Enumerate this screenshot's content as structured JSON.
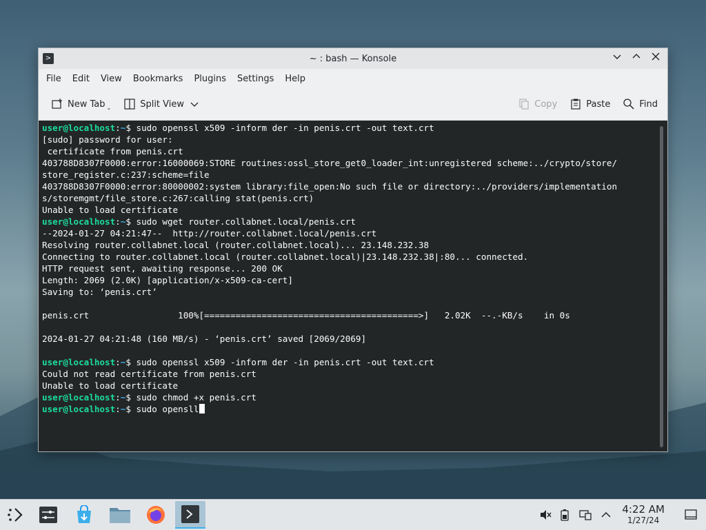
{
  "window": {
    "title": "~ : bash — Konsole",
    "controls": [
      "minimize",
      "maximize",
      "close"
    ]
  },
  "menubar": {
    "items": [
      "File",
      "Edit",
      "View",
      "Bookmarks",
      "Plugins",
      "Settings",
      "Help"
    ]
  },
  "toolbar": {
    "new_tab": "New Tab",
    "split_view": "Split View",
    "copy": "Copy",
    "paste": "Paste",
    "find": "Find"
  },
  "terminal": {
    "prompt_user": "user@localhost",
    "prompt_sep": ":",
    "prompt_path": "~",
    "prompt_end": "$ ",
    "lines": [
      {
        "type": "prompt",
        "cmd": "sudo openssl x509 -inform der -in penis.crt -out text.crt"
      },
      {
        "type": "out",
        "text": "[sudo] password for user:"
      },
      {
        "type": "out",
        "text": " certificate from penis.crt"
      },
      {
        "type": "out",
        "text": "403788D8307F0000:error:16000069:STORE routines:ossl_store_get0_loader_int:unregistered scheme:../crypto/store/"
      },
      {
        "type": "out",
        "text": "store_register.c:237:scheme=file"
      },
      {
        "type": "out",
        "text": "403788D8307F0000:error:80000002:system library:file_open:No such file or directory:../providers/implementation"
      },
      {
        "type": "out",
        "text": "s/storemgmt/file_store.c:267:calling stat(penis.crt)"
      },
      {
        "type": "out",
        "text": "Unable to load certificate"
      },
      {
        "type": "prompt",
        "cmd": "sudo wget router.collabnet.local/penis.crt"
      },
      {
        "type": "out",
        "text": "--2024-01-27 04:21:47--  http://router.collabnet.local/penis.crt"
      },
      {
        "type": "out",
        "text": "Resolving router.collabnet.local (router.collabnet.local)... 23.148.232.38"
      },
      {
        "type": "out",
        "text": "Connecting to router.collabnet.local (router.collabnet.local)|23.148.232.38|:80... connected."
      },
      {
        "type": "out",
        "text": "HTTP request sent, awaiting response... 200 OK"
      },
      {
        "type": "out",
        "text": "Length: 2069 (2.0K) [application/x-x509-ca-cert]"
      },
      {
        "type": "out",
        "text": "Saving to: ‘penis.crt’"
      },
      {
        "type": "out",
        "text": ""
      },
      {
        "type": "out",
        "text": "penis.crt                 100%[=========================================>]   2.02K  --.-KB/s    in 0s"
      },
      {
        "type": "out",
        "text": ""
      },
      {
        "type": "out",
        "text": "2024-01-27 04:21:48 (160 MB/s) - ‘penis.crt’ saved [2069/2069]"
      },
      {
        "type": "out",
        "text": ""
      },
      {
        "type": "prompt",
        "cmd": "sudo openssl x509 -inform der -in penis.crt -out text.crt"
      },
      {
        "type": "out",
        "text": "Could not read certificate from penis.crt"
      },
      {
        "type": "out",
        "text": "Unable to load certificate"
      },
      {
        "type": "prompt",
        "cmd": "sudo chmod +x penis.crt"
      },
      {
        "type": "prompt",
        "cmd": "sudo opensll",
        "cursor": true
      }
    ]
  },
  "taskbar": {
    "apps": [
      {
        "icon": "application-launcher-icon"
      },
      {
        "icon": "system-settings-icon"
      },
      {
        "icon": "discover-store-icon"
      },
      {
        "icon": "file-manager-icon"
      },
      {
        "icon": "firefox-icon"
      },
      {
        "icon": "konsole-icon",
        "active": true
      }
    ],
    "tray": [
      "volume-muted-icon",
      "battery-icon",
      "network-icon",
      "expand-tray-icon"
    ],
    "clock": {
      "time": "4:22 AM",
      "date": "1/27/24"
    }
  },
  "colors": {
    "terminal_bg": "#232627",
    "terminal_fg": "#fcfcfc",
    "prompt_user": "#1cdc9a",
    "prompt_path": "#3daee9",
    "accent": "#3daee9"
  }
}
